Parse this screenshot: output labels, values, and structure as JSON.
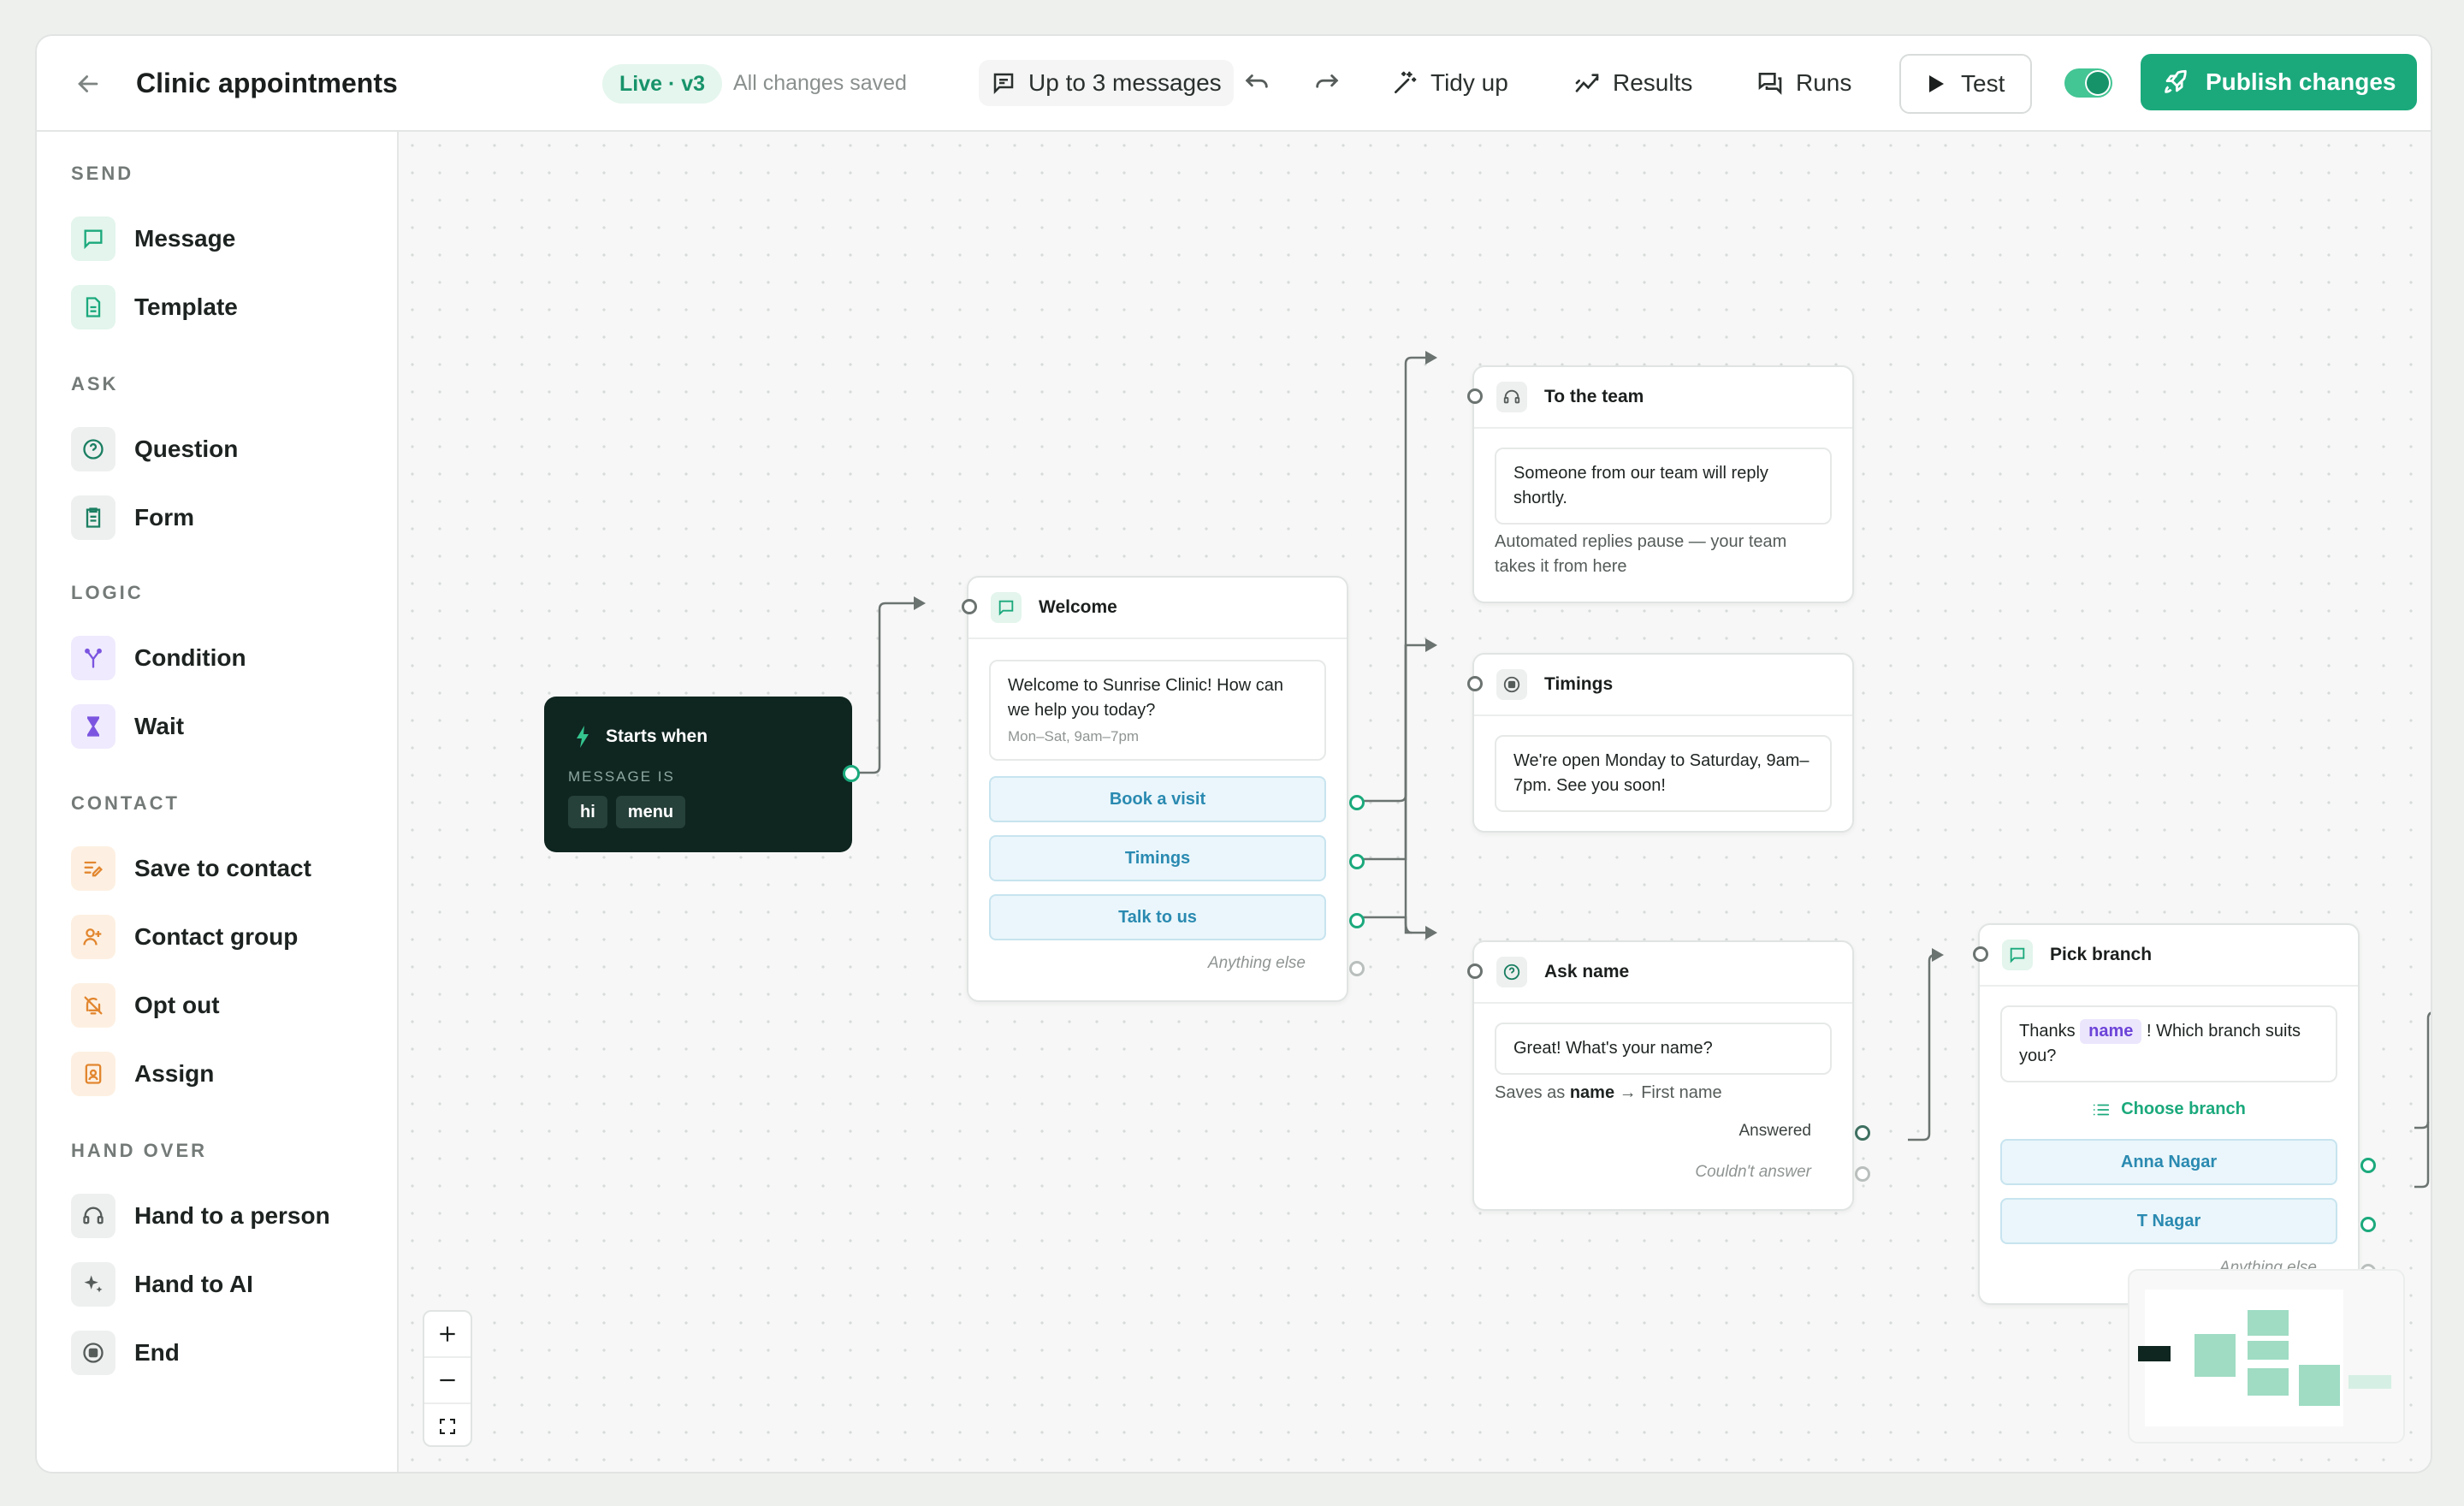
{
  "header": {
    "title": "Clinic appointments",
    "status": "Live · v3",
    "save_state": "All changes saved",
    "limit": "Up to 3 messages",
    "tidy": "Tidy up",
    "results": "Results",
    "runs": "Runs",
    "test": "Test",
    "publish": "Publish changes",
    "toggle_on": true
  },
  "sidebar": {
    "send": "SEND",
    "message": "Message",
    "template": "Template",
    "ask": "ASK",
    "question": "Question",
    "form": "Form",
    "logic": "LOGIC",
    "condition": "Condition",
    "wait": "Wait",
    "contact": "CONTACT",
    "save_contact": "Save to contact",
    "contact_group": "Contact group",
    "opt_out": "Opt out",
    "assign": "Assign",
    "handover": "HAND OVER",
    "person": "Hand to a person",
    "ai": "Hand to AI",
    "end": "End"
  },
  "start": {
    "title": "Starts when",
    "label": "MESSAGE IS",
    "chips": [
      "hi",
      "menu"
    ]
  },
  "welcome": {
    "title": "Welcome",
    "text": "Welcome to Sunrise Clinic! How can we help you today?",
    "hours": "Mon–Sat, 9am–7pm",
    "options": [
      "Book a visit",
      "Timings",
      "Talk to us"
    ],
    "fallback": "Anything else"
  },
  "team": {
    "title": "To the team",
    "text": "Someone from our team will reply shortly.",
    "note": "Automated replies pause — your team takes it from here"
  },
  "timings": {
    "title": "Timings",
    "text": "We're open Monday to Saturday, 9am–7pm. See you soon!"
  },
  "askname": {
    "title": "Ask name",
    "text": "Great! What's your name?",
    "save_prefix": "Saves as",
    "save_var": "name",
    "save_target": "→ First name",
    "answered": "Answered",
    "failed": "Couldn't answer"
  },
  "branch": {
    "title": "Pick branch",
    "text_before": "Thanks",
    "var": "name",
    "text_after": "! Which branch suits you?",
    "list_button": "Choose branch",
    "options": [
      "Anna Nagar",
      "T Nagar"
    ],
    "fallback": "Anything else"
  },
  "colors": {
    "accent": "#1ba97c",
    "start_bg": "#0f2520",
    "option_text": "#2a8ab1",
    "variable": "#6c44d8"
  }
}
